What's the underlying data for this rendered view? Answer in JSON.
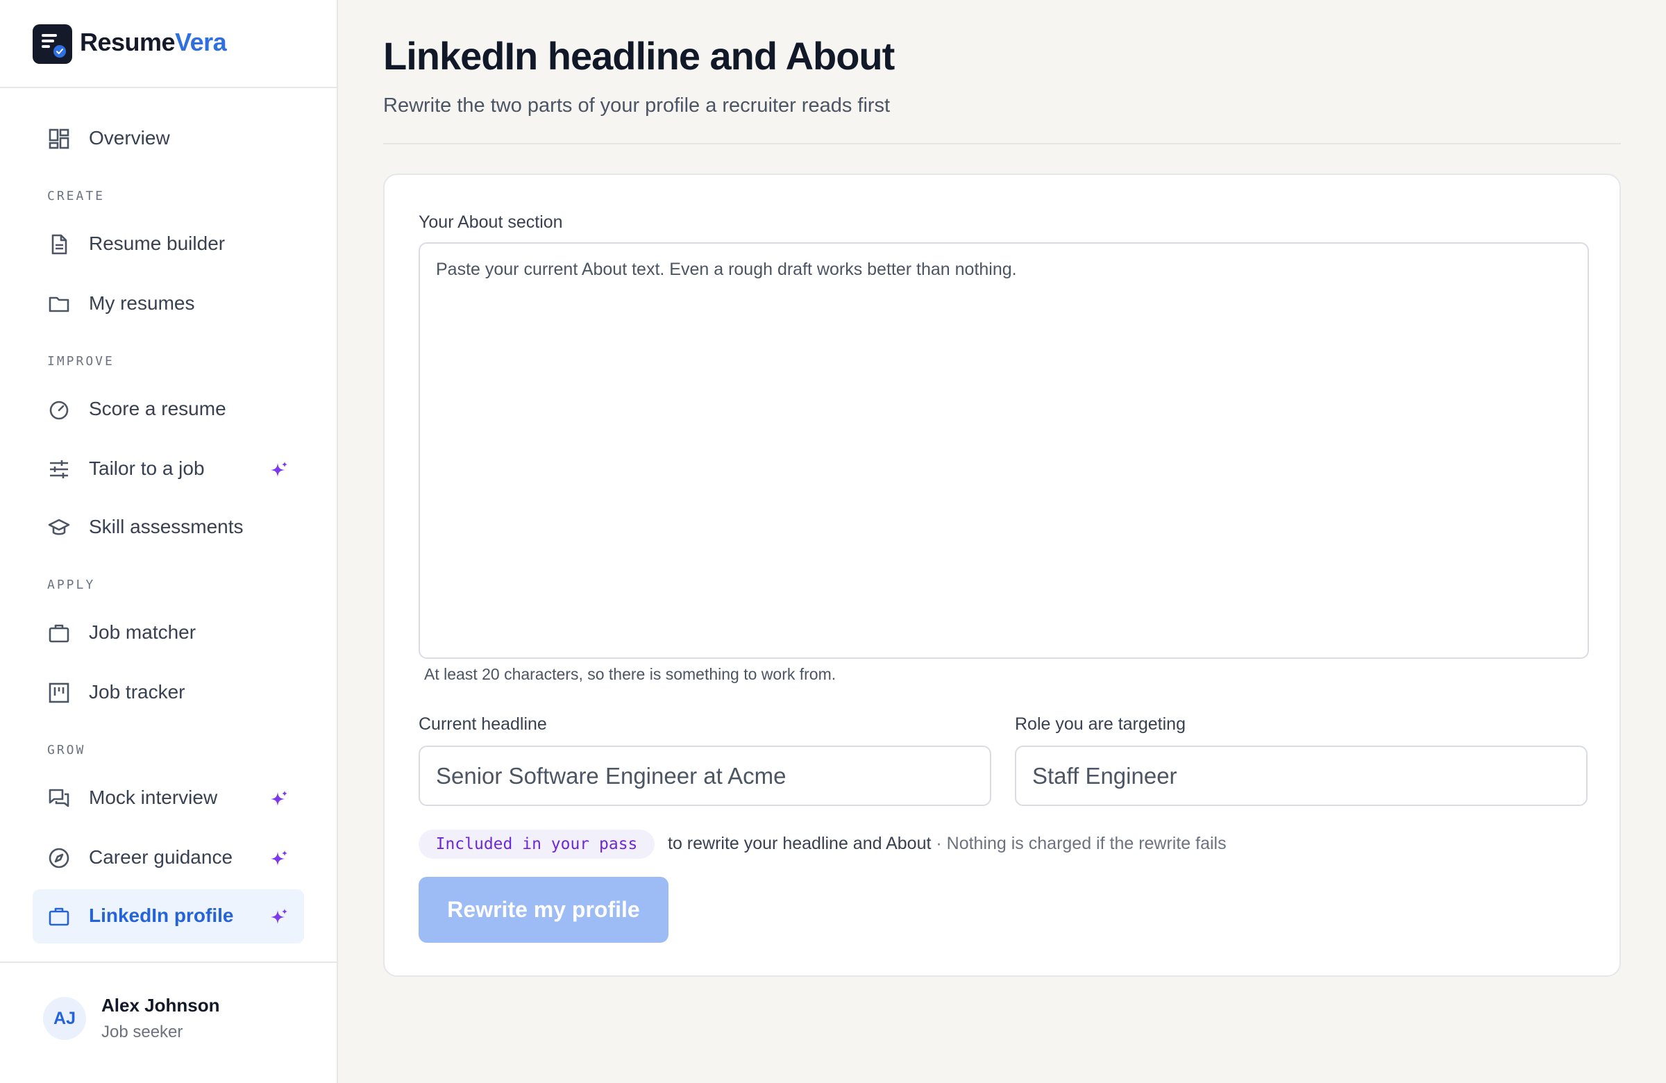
{
  "brand": {
    "name_part1": "Resume",
    "name_part2": "Vera"
  },
  "sidebar": {
    "overview": {
      "label": "Overview"
    },
    "sections": {
      "create": "CREATE",
      "improve": "IMPROVE",
      "apply": "APPLY",
      "grow": "GROW"
    },
    "items": {
      "resume_builder": {
        "label": "Resume builder"
      },
      "my_resumes": {
        "label": "My resumes"
      },
      "score_resume": {
        "label": "Score a resume"
      },
      "tailor_job": {
        "label": "Tailor to a job",
        "ai": true
      },
      "skill_assessments": {
        "label": "Skill assessments"
      },
      "job_matcher": {
        "label": "Job matcher"
      },
      "job_tracker": {
        "label": "Job tracker"
      },
      "mock_interview": {
        "label": "Mock interview",
        "ai": true
      },
      "career_guidance": {
        "label": "Career guidance",
        "ai": true
      },
      "linkedin_profile": {
        "label": "LinkedIn profile",
        "ai": true,
        "active": true
      }
    }
  },
  "user": {
    "initials": "AJ",
    "name": "Alex Johnson",
    "role": "Job seeker"
  },
  "page": {
    "title": "LinkedIn headline and About",
    "subtitle": "Rewrite the two parts of your profile a recruiter reads first"
  },
  "form": {
    "about": {
      "label": "Your About section",
      "placeholder": "Paste your current About text. Even a rough draft works better than nothing.",
      "value": "",
      "hint": "At least 20 characters, so there is something to work from."
    },
    "headline": {
      "label": "Current headline",
      "placeholder": "Senior Software Engineer at Acme",
      "value": ""
    },
    "target_role": {
      "label": "Role you are targeting",
      "placeholder": "Staff Engineer",
      "value": ""
    },
    "pass": {
      "badge": "Included in your pass",
      "text": "to rewrite your headline and About",
      "separator": " · ",
      "note": "Nothing is charged if the rewrite fails"
    },
    "submit_label": "Rewrite my profile",
    "submit_disabled": true
  },
  "colors": {
    "accent": "#2563d8",
    "ai_spark": "#7c3aed",
    "button_disabled": "#9dbbf4",
    "badge_text": "#6d28d9",
    "active_bg": "#eef4fd"
  },
  "icons": {
    "overview": "dashboard-grid-icon",
    "resume_builder": "document-icon",
    "my_resumes": "folder-icon",
    "score_resume": "gauge-icon",
    "tailor_job": "sliders-icon",
    "skill_assessments": "graduation-cap-icon",
    "job_matcher": "briefcase-icon",
    "job_tracker": "kanban-icon",
    "mock_interview": "chat-bubbles-icon",
    "career_guidance": "compass-icon",
    "linkedin_profile": "briefcase-icon",
    "ai_feature": "sparkle-icon"
  }
}
